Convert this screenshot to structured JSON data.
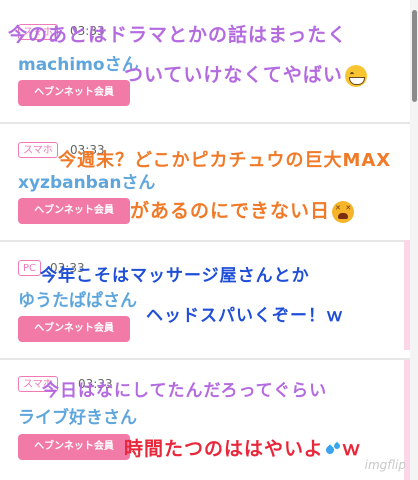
{
  "posts": [
    {
      "tag": "スマホ",
      "time": "03:33",
      "user": "machimoさん",
      "member": "ヘブンネット会員"
    },
    {
      "tag": "スマホ",
      "time": "03:33",
      "user": "xyzbanbanさん",
      "member": "ヘブンネット会員"
    },
    {
      "tag": "PC",
      "time": "03:33",
      "user": "ゆうたぱぱさん",
      "member": "ヘブンネット会員"
    },
    {
      "tag": "スマホ",
      "time": "03:33",
      "user": "ライブ好きさん",
      "member": "ヘブンネット会員"
    }
  ],
  "overlay_text": {
    "line1": "今のあとはドラマとかの話はまったく",
    "line2": "ついていけなくてやばい",
    "line3": "今週末？どこかピカチュウの巨大MAX",
    "line4": "があるのにできない日",
    "line5": "今年こそはマッサージ屋さんとか",
    "line6": "ヘッドスパいくぞー！ｗ",
    "line7": "今日はなにしてたんだろってぐらい",
    "line8": "時間たつのははやいよ",
    "line8_suffix": "ｗ"
  },
  "emojis": {
    "e1": "grinning-sweat-emoji",
    "e2": "tired-face-emoji",
    "e3": "sweat-droplets-emoji"
  },
  "watermark": "imgflip",
  "colors": {
    "user_blue": "#5ea6dc",
    "member_pink": "#f27aa6",
    "tag_pink": "#f07ab8",
    "overlay_purple": "#b46be0",
    "overlay_orange": "#f07a28",
    "overlay_blue": "#1f4fd8",
    "overlay_red": "#e8273a"
  }
}
